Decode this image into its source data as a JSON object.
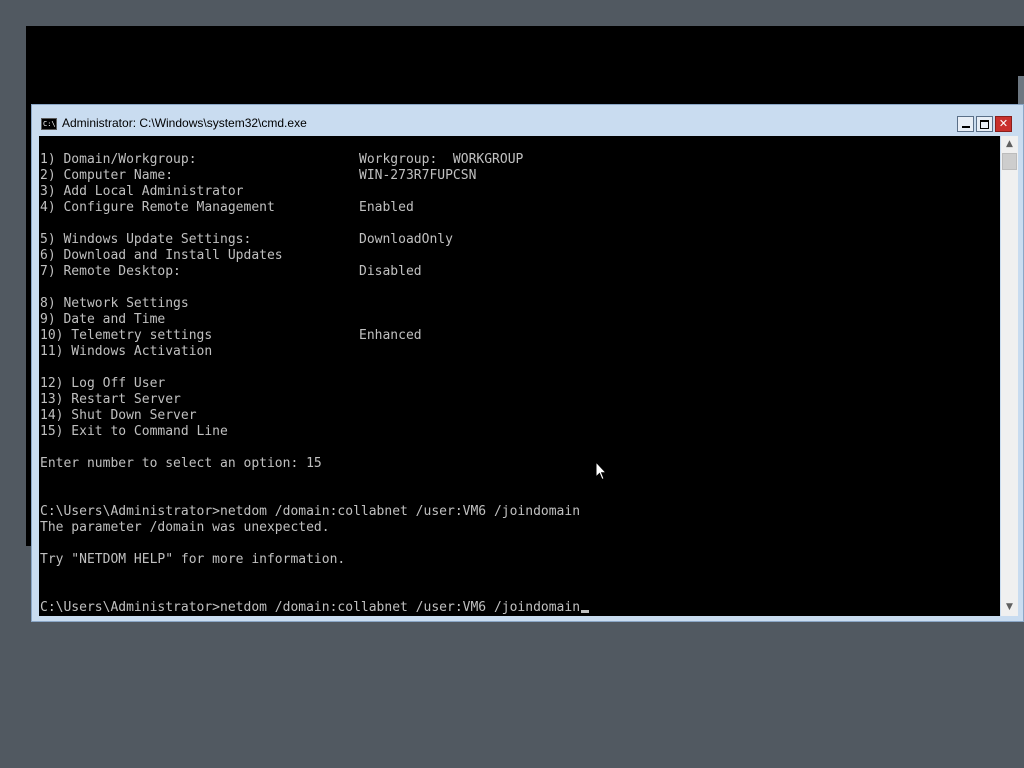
{
  "window": {
    "title": "Administrator: C:\\Windows\\system32\\cmd.exe",
    "icon_text": "C:\\",
    "close_label": "✕"
  },
  "menu": [
    {
      "label": "1) Domain/Workgroup:",
      "value": "Workgroup:  WORKGROUP"
    },
    {
      "label": "2) Computer Name:",
      "value": "WIN-273R7FUPCSN"
    },
    {
      "label": "3) Add Local Administrator",
      "value": ""
    },
    {
      "label": "4) Configure Remote Management",
      "value": "Enabled"
    },
    {
      "label": "5) Windows Update Settings:",
      "value": "DownloadOnly"
    },
    {
      "label": "6) Download and Install Updates",
      "value": ""
    },
    {
      "label": "7) Remote Desktop:",
      "value": "Disabled"
    },
    {
      "label": "8) Network Settings",
      "value": ""
    },
    {
      "label": "9) Date and Time",
      "value": ""
    },
    {
      "label": "10) Telemetry settings",
      "value": "Enhanced"
    },
    {
      "label": "11) Windows Activation",
      "value": ""
    },
    {
      "label": "12) Log Off User",
      "value": ""
    },
    {
      "label": "13) Restart Server",
      "value": ""
    },
    {
      "label": "14) Shut Down Server",
      "value": ""
    },
    {
      "label": "15) Exit to Command Line",
      "value": ""
    }
  ],
  "console": {
    "prompt_select": "Enter number to select an option: 15",
    "command_1": "C:\\Users\\Administrator>netdom /domain:collabnet /user:VM6 /joindomain",
    "error_1": "The parameter /domain was unexpected.",
    "help_hint": "Try \"NETDOM HELP\" for more information.",
    "command_2": "C:\\Users\\Administrator>netdom /domain:collabnet /user:VM6 /joindomain"
  },
  "icons": {
    "app": "cmd-icon",
    "minimize": "minimize-icon",
    "maximize": "maximize-icon",
    "close": "close-icon",
    "scroll_up": "scroll-up-arrow-icon",
    "scroll_down": "scroll-down-arrow-icon",
    "pointer": "mouse-pointer-icon"
  },
  "colors": {
    "console_bg": "#000000",
    "console_text": "#c0c0c0",
    "desktop_bg": "#515961",
    "titlebar_bg": "#c9dcf0",
    "close_button": "#c9302c"
  }
}
